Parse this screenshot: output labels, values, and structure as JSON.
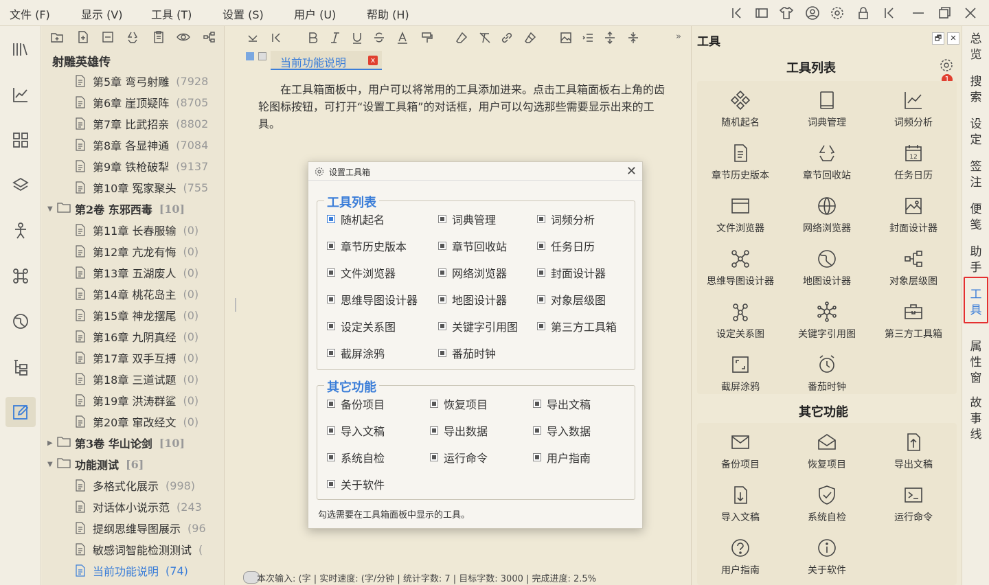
{
  "menu": [
    "文件 (F)",
    "显示 (V)",
    "工具 (T)",
    "设置 (S)",
    "用户 (U)",
    "帮助 (H)"
  ],
  "tree": {
    "book_title": "射雕英雄传",
    "rows": [
      {
        "label": "第5章 弯弓射雕",
        "count": "(7928",
        "type": "ch"
      },
      {
        "label": "第6章 崖顶疑阵",
        "count": "(8705",
        "type": "ch"
      },
      {
        "label": "第7章 比武招亲",
        "count": "(8802",
        "type": "ch"
      },
      {
        "label": "第8章 各显神通",
        "count": "(7084",
        "type": "ch"
      },
      {
        "label": "第9章 铁枪破犁",
        "count": "(9137",
        "type": "ch"
      },
      {
        "label": "第10章 冤家聚头",
        "count": "(755",
        "type": "ch"
      },
      {
        "label": "第2卷 东邪西毒",
        "count": "[10]",
        "type": "vol",
        "open": true
      },
      {
        "label": "第11章 长春服输",
        "count": "(0)",
        "type": "ch"
      },
      {
        "label": "第12章 亢龙有悔",
        "count": "(0)",
        "type": "ch"
      },
      {
        "label": "第13章 五湖废人",
        "count": "(0)",
        "type": "ch"
      },
      {
        "label": "第14章 桃花岛主",
        "count": "(0)",
        "type": "ch"
      },
      {
        "label": "第15章 神龙摆尾",
        "count": "(0)",
        "type": "ch"
      },
      {
        "label": "第16章 九阴真经",
        "count": "(0)",
        "type": "ch"
      },
      {
        "label": "第17章 双手互搏",
        "count": "(0)",
        "type": "ch"
      },
      {
        "label": "第18章 三道试题",
        "count": "(0)",
        "type": "ch"
      },
      {
        "label": "第19章 洪涛群鲨",
        "count": "(0)",
        "type": "ch"
      },
      {
        "label": "第20章 窜改经文",
        "count": "(0)",
        "type": "ch"
      },
      {
        "label": "第3卷 华山论剑",
        "count": "[10]",
        "type": "vol",
        "open": false
      },
      {
        "label": "功能测试",
        "count": "[6]",
        "type": "vol",
        "open": true
      },
      {
        "label": "多格式化展示",
        "count": "(998)",
        "type": "ch"
      },
      {
        "label": "对话体小说示范",
        "count": "(243",
        "type": "ch"
      },
      {
        "label": "提纲思维导图展示",
        "count": "(96",
        "type": "ch"
      },
      {
        "label": "敏感词智能检测测试",
        "count": "(",
        "type": "ch"
      },
      {
        "label": "当前功能说明",
        "count": "(74)",
        "type": "ch",
        "selected": true
      }
    ]
  },
  "editor": {
    "tab_label": "当前功能说明",
    "tab_close": "x",
    "body": "在工具箱面板中，用户可以将常用的工具添加进来。点击工具箱面板右上角的齿轮图标按钮，可打开“设置工具箱”的对话框，用户可以勾选那些需要显示出来的工具。",
    "status": "本次输入: (字 | 实时速度: (字/分钟 | 统计字数: 7 | 目标字数: 3000 | 完成进度: 2.5%"
  },
  "dialog": {
    "title": "设置工具箱",
    "close": "✕",
    "group1_title": "工具列表",
    "group1": [
      "随机起名",
      "词典管理",
      "词频分析",
      "章节历史版本",
      "章节回收站",
      "任务日历",
      "文件浏览器",
      "网络浏览器",
      "封面设计器",
      "思维导图设计器",
      "地图设计器",
      "对象层级图",
      "设定关系图",
      "关键字引用图",
      "第三方工具箱",
      "截屏涂鸦",
      "番茄时钟"
    ],
    "group2_title": "其它功能",
    "group2": [
      "备份项目",
      "恢复项目",
      "导出文稿",
      "导入文稿",
      "导出数据",
      "导入数据",
      "系统自检",
      "运行命令",
      "用户指南",
      "关于软件"
    ],
    "hint": "勾选需要在工具箱面板中显示的工具。"
  },
  "toolpanel": {
    "title": "工具",
    "pin": "🗗",
    "close": "✕",
    "section1": "工具列表",
    "badge": "1",
    "tools": [
      {
        "label": "随机起名",
        "icon": "diamond-grid-icon"
      },
      {
        "label": "词典管理",
        "icon": "book-icon"
      },
      {
        "label": "词频分析",
        "icon": "line-chart-icon"
      },
      {
        "label": "章节历史版本",
        "icon": "file-history-icon"
      },
      {
        "label": "章节回收站",
        "icon": "recycle-icon"
      },
      {
        "label": "任务日历",
        "icon": "calendar-icon"
      },
      {
        "label": "文件浏览器",
        "icon": "window-icon"
      },
      {
        "label": "网络浏览器",
        "icon": "globe-icon"
      },
      {
        "label": "封面设计器",
        "icon": "image-icon"
      },
      {
        "label": "思维导图设计器",
        "icon": "mindmap-icon"
      },
      {
        "label": "地图设计器",
        "icon": "map-globe-icon"
      },
      {
        "label": "对象层级图",
        "icon": "hierarchy-icon"
      },
      {
        "label": "设定关系图",
        "icon": "relation-icon"
      },
      {
        "label": "关键字引用图",
        "icon": "network-icon"
      },
      {
        "label": "第三方工具箱",
        "icon": "toolbox-icon"
      },
      {
        "label": "截屏涂鸦",
        "icon": "screenshot-icon"
      },
      {
        "label": "番茄时钟",
        "icon": "alarm-icon"
      }
    ],
    "section2": "其它功能",
    "others": [
      {
        "label": "备份项目",
        "icon": "mail-icon"
      },
      {
        "label": "恢复项目",
        "icon": "mail-open-icon"
      },
      {
        "label": "导出文稿",
        "icon": "export-icon"
      },
      {
        "label": "导入文稿",
        "icon": "import-icon"
      },
      {
        "label": "系统自检",
        "icon": "shield-check-icon"
      },
      {
        "label": "运行命令",
        "icon": "terminal-icon"
      },
      {
        "label": "用户指南",
        "icon": "help-icon"
      },
      {
        "label": "关于软件",
        "icon": "info-icon"
      }
    ]
  },
  "rightrail": [
    "总览",
    "搜索",
    "设定",
    "签注",
    "便笺",
    "助手",
    "工具",
    "属性窗",
    "故事线"
  ],
  "colors": {
    "accent": "#3a7dd8",
    "badge": "#e04030",
    "highlight_frame": "#e53030"
  }
}
